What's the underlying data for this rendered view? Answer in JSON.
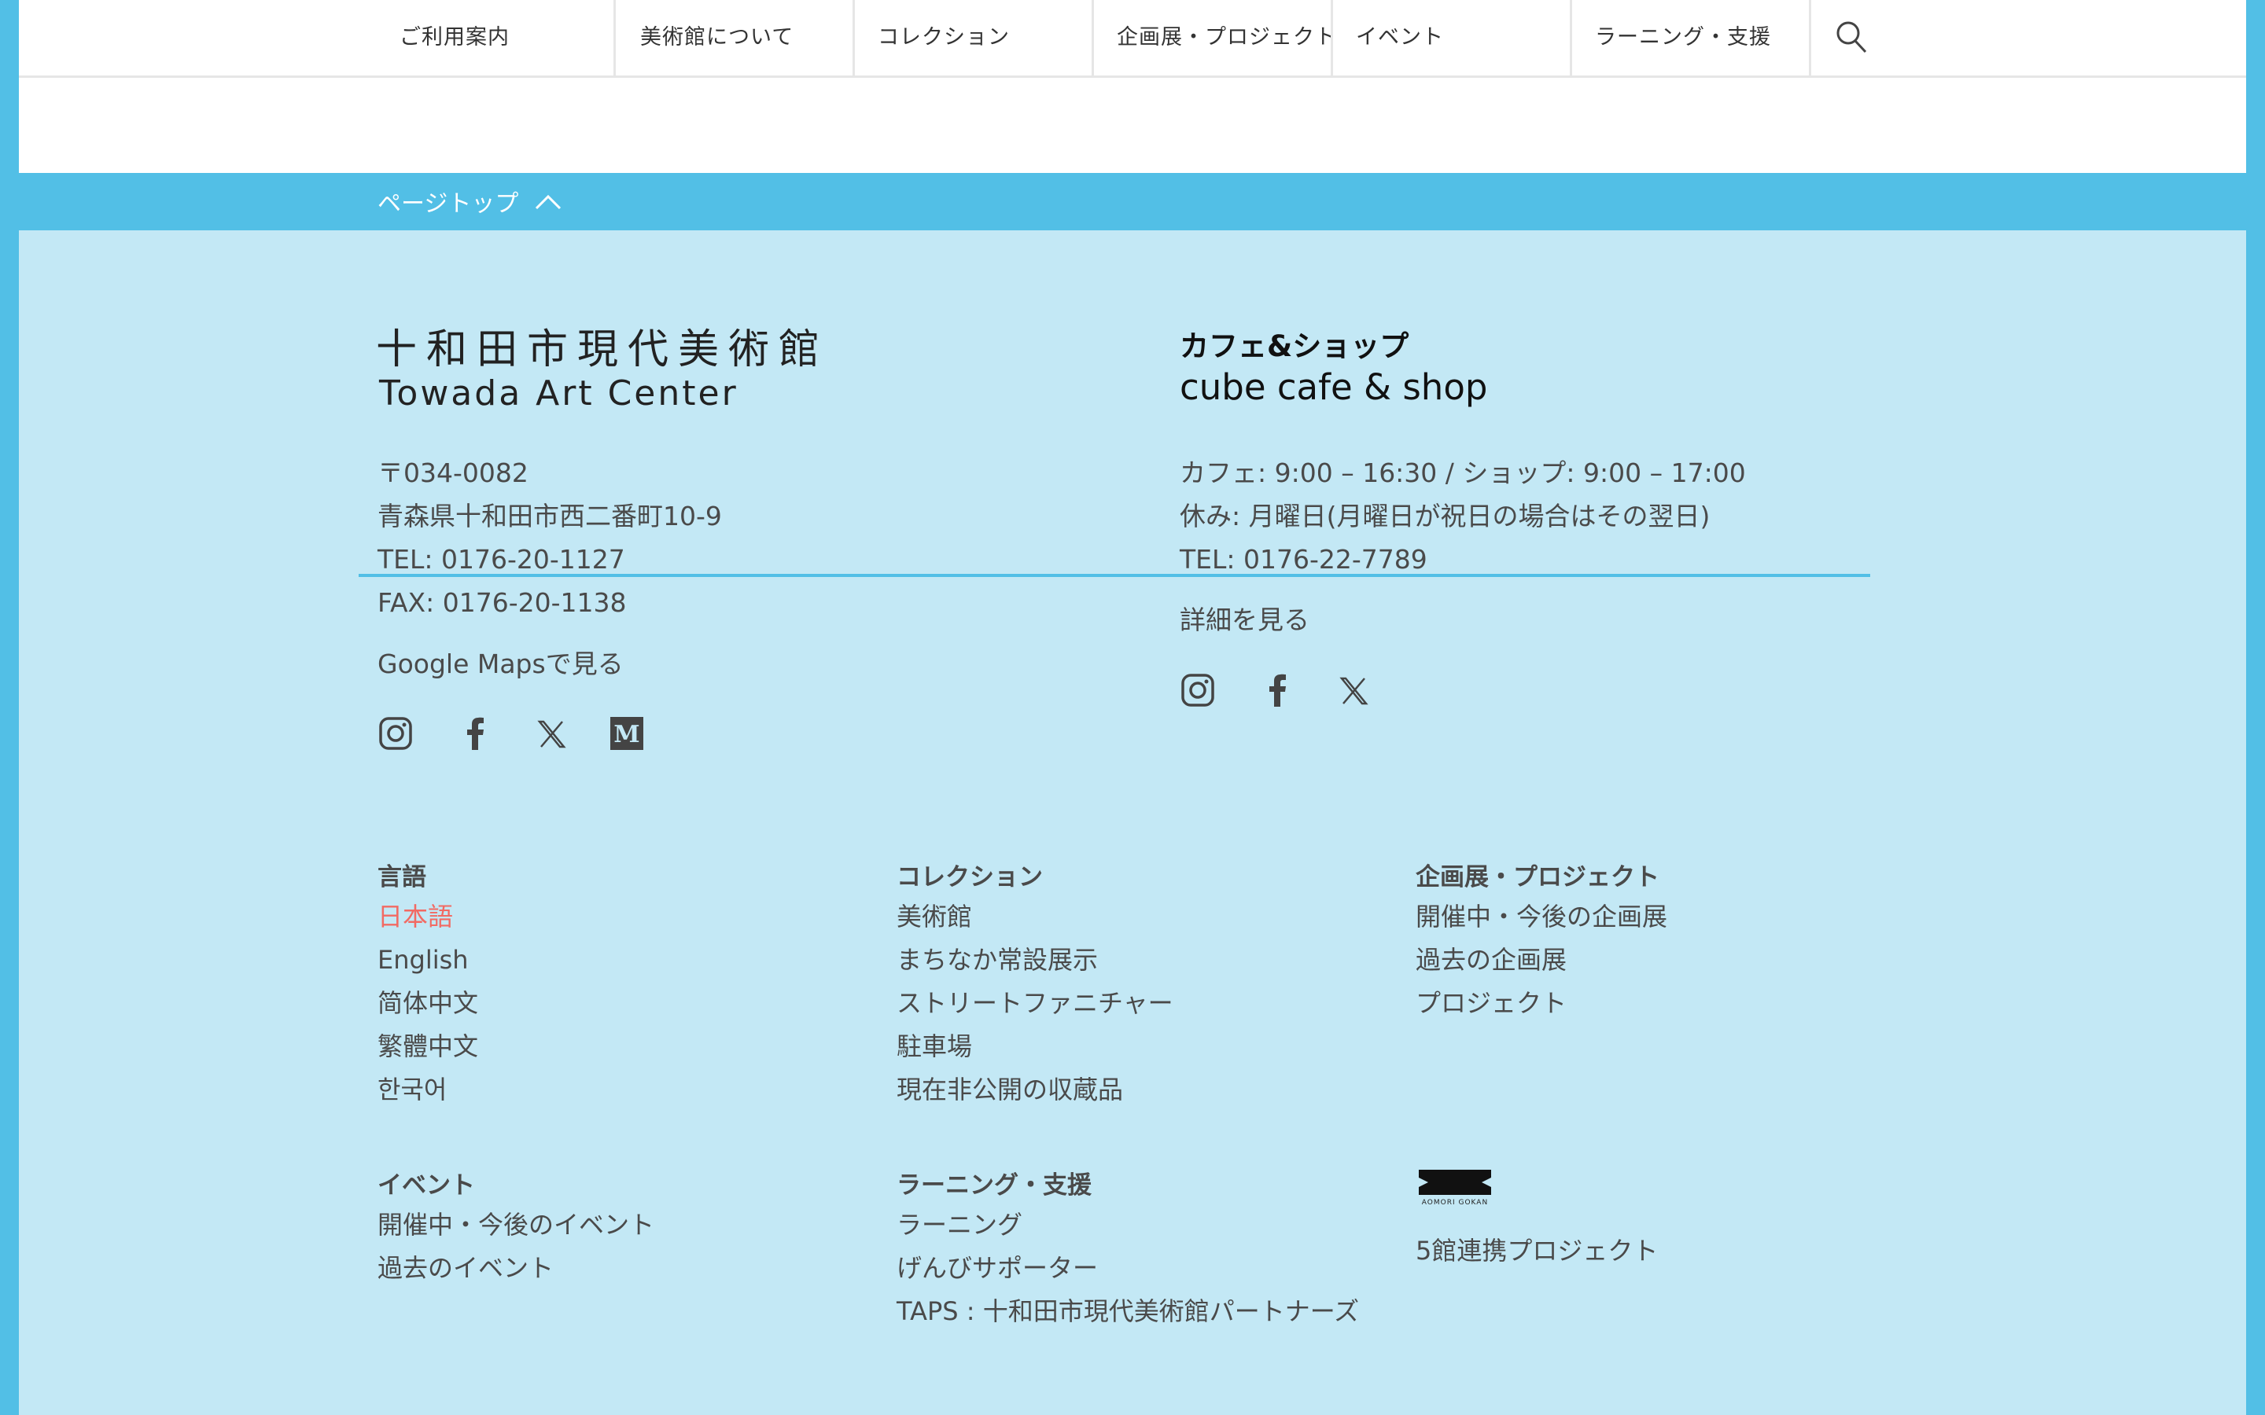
{
  "nav": {
    "items": [
      "ご利用案内",
      "美術館について",
      "コレクション",
      "企画展・プロジェクト",
      "イベント",
      "ラーニング・支援"
    ],
    "search_icon": "search-icon"
  },
  "pagetop": {
    "label": "ページトップ",
    "icon": "chevron-up-icon"
  },
  "museum": {
    "name_jp": "十和田市現代美術館",
    "name_en": "Towada Art Center",
    "postal": "〒034-0082",
    "address": "青森県十和田市西二番町10-9",
    "tel": "TEL: 0176-20-1127",
    "fax": "FAX: 0176-20-1138",
    "maps_link": "Google Mapsで見る",
    "social_icons": [
      "instagram-icon",
      "facebook-icon",
      "x-icon",
      "medium-icon"
    ]
  },
  "cafe": {
    "title_jp": "カフェ&ショップ",
    "title_en": "cube cafe & shop",
    "hours": "カフェ: 9:00 – 16:30 / ショップ: 9:00 – 17:00",
    "closed": "休み: 月曜日(月曜日が祝日の場合はその翌日)",
    "tel": "TEL: 0176-22-7789",
    "details_link": "詳細を見る",
    "social_icons": [
      "instagram-icon",
      "facebook-icon",
      "x-icon"
    ]
  },
  "footer_nav": {
    "language": {
      "heading": "言語",
      "items": [
        "日本語",
        "English",
        "简体中文",
        "繁體中文",
        "한국어"
      ],
      "active_color": "#f26a63"
    },
    "collection": {
      "heading": "コレクション",
      "items": [
        "美術館",
        "まちなか常設展示",
        "ストリートファニチャー",
        "駐車場",
        "現在非公開の収蔵品"
      ]
    },
    "exhibitions": {
      "heading": "企画展・プロジェクト",
      "items": [
        "開催中・今後の企画展",
        "過去の企画展",
        "プロジェクト"
      ]
    },
    "events": {
      "heading": "イベント",
      "items": [
        "開催中・今後のイベント",
        "過去のイベント"
      ]
    },
    "learning": {
      "heading": "ラーニング・支援",
      "items": [
        "ラーニング",
        "げんびサポーター",
        "TAPS : 十和田市現代美術館パートナーズ"
      ]
    },
    "aomori": {
      "logo_text": "AOMORI GOKAN",
      "link": "5館連携プロジェクト"
    }
  },
  "colors": {
    "accent": "#52bfe6",
    "footer_bg": "#c3e8f5",
    "active": "#f26a63"
  }
}
